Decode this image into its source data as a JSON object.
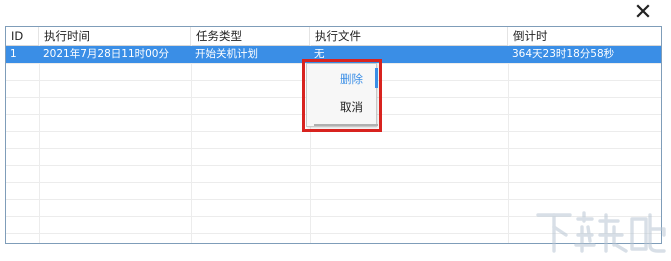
{
  "window": {
    "close_icon": "close-icon"
  },
  "table": {
    "columns": [
      "ID",
      "执行时间",
      "任务类型",
      "执行文件",
      "倒计时"
    ],
    "rows": [
      {
        "id": "1",
        "time": "2021年7月28日11时00分",
        "type": "开始关机计划",
        "file": "无",
        "countdown": "364天23时18分58秒"
      }
    ]
  },
  "context_menu": {
    "items": [
      "删除",
      "取消"
    ]
  },
  "watermark": {
    "text": "下载吧"
  },
  "colors": {
    "selection": "#3a8ee6",
    "highlight": "#d8231f",
    "border": "#7f9db9"
  }
}
